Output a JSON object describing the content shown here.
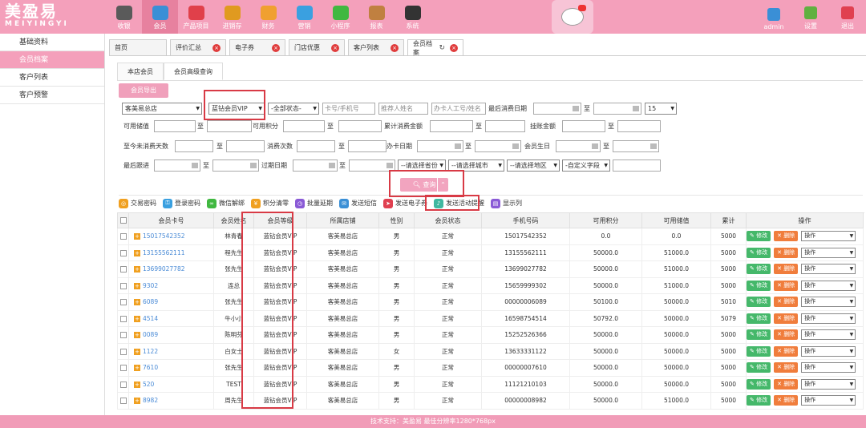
{
  "brand": {
    "name_cn": "美盈易",
    "name_en": "MEIYINGYI"
  },
  "nav": [
    {
      "label": "收银",
      "icon": "cash-register-icon",
      "color": "#5a5a5a"
    },
    {
      "label": "会员",
      "icon": "member-icon",
      "color": "#3a8fd6",
      "active": true
    },
    {
      "label": "产品项目",
      "icon": "product-icon",
      "color": "#e0404a"
    },
    {
      "label": "进销存",
      "icon": "inventory-icon",
      "color": "#e09a20"
    },
    {
      "label": "财务",
      "icon": "finance-icon",
      "color": "#f0a030"
    },
    {
      "label": "营销",
      "icon": "megaphone-icon",
      "color": "#3aa0e0"
    },
    {
      "label": "小程序",
      "icon": "wechat-icon",
      "color": "#40b840"
    },
    {
      "label": "报表",
      "icon": "report-icon",
      "color": "#c08040"
    },
    {
      "label": "系统",
      "icon": "monitor-icon",
      "color": "#333333"
    }
  ],
  "top_right": [
    {
      "label": "admin",
      "icon": "user-icon",
      "color": "#3a8fd6"
    },
    {
      "label": "设置",
      "icon": "settings-icon",
      "color": "#60b040"
    },
    {
      "label": "退出",
      "icon": "logout-icon",
      "color": "#e04050"
    }
  ],
  "sidebar": {
    "items": [
      {
        "label": "基础资料"
      },
      {
        "label": "会员档案",
        "active": true
      },
      {
        "label": "客户列表"
      },
      {
        "label": "客户预警"
      }
    ]
  },
  "tabs": [
    {
      "label": "首页",
      "closable": false
    },
    {
      "label": "评价汇总",
      "closable": true
    },
    {
      "label": "电子券",
      "closable": true
    },
    {
      "label": "门店优惠",
      "closable": true
    },
    {
      "label": "客户列表",
      "closable": true
    },
    {
      "label": "会员档案",
      "closable": true,
      "active": true
    }
  ],
  "subtabs": [
    {
      "label": "本店会员"
    },
    {
      "label": "会员高级查询",
      "active": true
    }
  ],
  "export_label": "会员导出",
  "filters": {
    "store": "客美易总店",
    "level": "蓝钻会员VIP",
    "status": "-全部状态-",
    "card_placeholder": "卡号/手机号",
    "referrer_placeholder": "推荐人姓名",
    "staff_placeholder": "办卡人工号/姓名",
    "last_consume_label": "最后消费日期",
    "to": "至",
    "page_size": "15",
    "stored_value_label": "可用储值",
    "points_label": "可用积分",
    "total_consume_label": "累计消费金额",
    "credit_label": "挂账金额",
    "days_since_label": "至今未消费天数",
    "consume_count_label": "消费次数",
    "card_date_label": "办卡日期",
    "birthday_label": "会员生日",
    "follow_label": "最后跟进",
    "expire_label": "过期日期",
    "province": "--请选择省份",
    "city": "--请选择城市",
    "district": "--请选择地区",
    "custom": "-自定义字段"
  },
  "query_label": "查询",
  "toolbar": [
    {
      "label": "交易密码",
      "icon": "lock-icon",
      "color": "#f0a020"
    },
    {
      "label": "登录密码",
      "icon": "key-icon",
      "color": "#3aa0e0"
    },
    {
      "label": "微信解绑",
      "icon": "link-icon",
      "color": "#40b840"
    },
    {
      "label": "积分清零",
      "icon": "coin-icon",
      "color": "#f0a020"
    },
    {
      "label": "批量延期",
      "icon": "clock-icon",
      "color": "#8a5ad6"
    },
    {
      "label": "发送短信",
      "icon": "sms-icon",
      "color": "#3a8fd6"
    },
    {
      "label": "发送电子券",
      "icon": "send-icon",
      "color": "#e04050"
    },
    {
      "label": "发送活动提醒",
      "icon": "bell-icon",
      "color": "#40b8a0"
    },
    {
      "label": "显示列",
      "icon": "columns-icon",
      "color": "#8a5ad6"
    }
  ],
  "table": {
    "headers": [
      "会员卡号",
      "会员姓名",
      "会员等级",
      "所属店铺",
      "性别",
      "会员状态",
      "手机号码",
      "可用积分",
      "可用储值",
      "累计",
      "操作"
    ],
    "edit_label": "修改",
    "delete_label": "删除",
    "op_label": "操作",
    "rows": [
      {
        "card": "15017542352",
        "name": "林青春",
        "level": "蓝钻会员VIP",
        "store": "客美易总店",
        "gender": "男",
        "status": "正常",
        "phone": "15017542352",
        "points": "0.0",
        "balance": "0.0",
        "total": "5000"
      },
      {
        "card": "13155562111",
        "name": "程先生",
        "level": "蓝钻会员VIP",
        "store": "客美易总店",
        "gender": "男",
        "status": "正常",
        "phone": "13155562111",
        "points": "50000.0",
        "balance": "51000.0",
        "total": "5000"
      },
      {
        "card": "13699027782",
        "name": "张先生",
        "level": "蓝钻会员VIP",
        "store": "客美易总店",
        "gender": "男",
        "status": "正常",
        "phone": "13699027782",
        "points": "50000.0",
        "balance": "51000.0",
        "total": "5000"
      },
      {
        "card": "9302",
        "name": "连总",
        "level": "蓝钻会员VIP",
        "store": "客美易总店",
        "gender": "男",
        "status": "正常",
        "phone": "15659999302",
        "points": "50000.0",
        "balance": "51000.0",
        "total": "5000"
      },
      {
        "card": "6089",
        "name": "张先生",
        "level": "蓝钻会员VIP",
        "store": "客美易总店",
        "gender": "男",
        "status": "正常",
        "phone": "00000006089",
        "points": "50100.0",
        "balance": "50000.0",
        "total": "5010"
      },
      {
        "card": "4514",
        "name": "牛小小",
        "level": "蓝钻会员VIP",
        "store": "客美易总店",
        "gender": "男",
        "status": "正常",
        "phone": "16598754514",
        "points": "50792.0",
        "balance": "50000.0",
        "total": "5079"
      },
      {
        "card": "0089",
        "name": "陈明芬",
        "level": "蓝钻会员VIP",
        "store": "客美易总店",
        "gender": "男",
        "status": "正常",
        "phone": "15252526366",
        "points": "50000.0",
        "balance": "50000.0",
        "total": "5000"
      },
      {
        "card": "1122",
        "name": "白女士",
        "level": "蓝钻会员VIP",
        "store": "客美易总店",
        "gender": "女",
        "status": "正常",
        "phone": "13633331122",
        "points": "50000.0",
        "balance": "50000.0",
        "total": "5000"
      },
      {
        "card": "7610",
        "name": "张先生",
        "level": "蓝钻会员VIP",
        "store": "客美易总店",
        "gender": "男",
        "status": "正常",
        "phone": "00000007610",
        "points": "50000.0",
        "balance": "50000.0",
        "total": "5000"
      },
      {
        "card": "520",
        "name": "TEST",
        "level": "蓝钻会员VIP",
        "store": "客美易总店",
        "gender": "男",
        "status": "正常",
        "phone": "11121210103",
        "points": "50000.0",
        "balance": "50000.0",
        "total": "5000"
      },
      {
        "card": "8982",
        "name": "周先生",
        "level": "蓝钻会员VIP",
        "store": "客美易总店",
        "gender": "男",
        "status": "正常",
        "phone": "00000008982",
        "points": "50000.0",
        "balance": "51000.0",
        "total": "5000"
      }
    ]
  },
  "footer": "技术支持：美盈易    最佳分辨率1280*768px"
}
